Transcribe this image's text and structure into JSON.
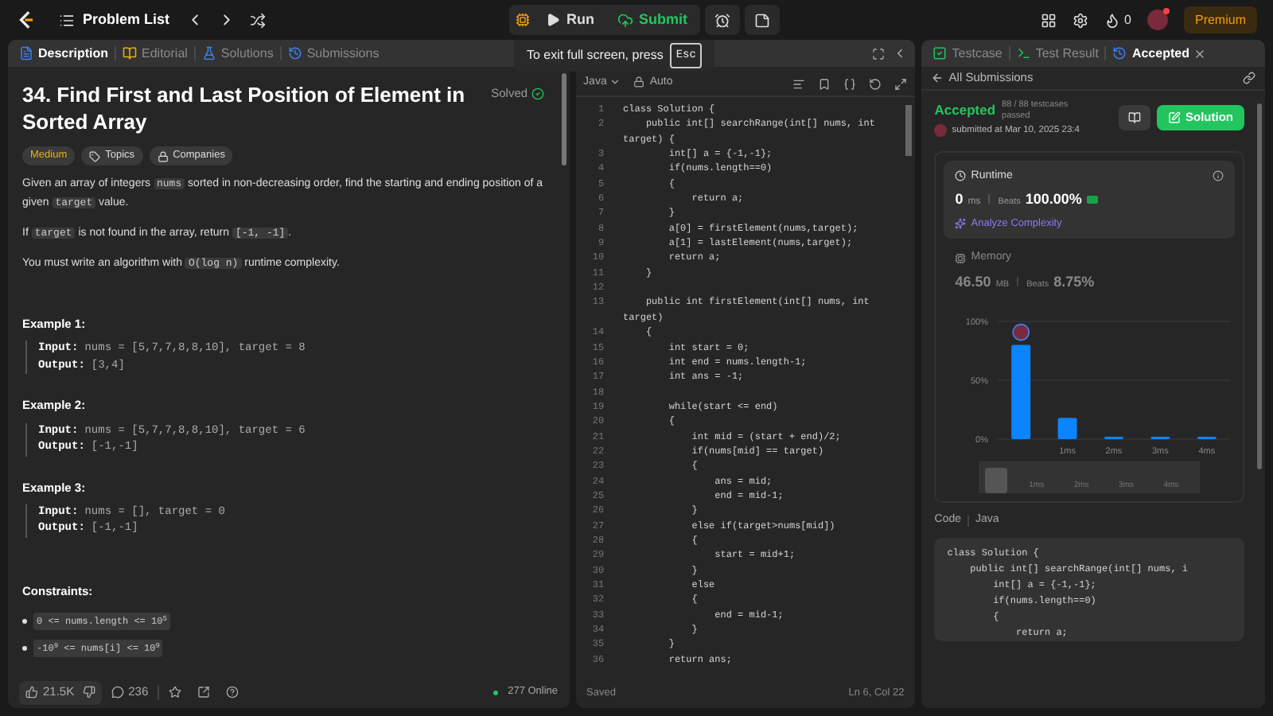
{
  "top_bar": {
    "title": "Problem List",
    "run": "Run",
    "submit": "Submit",
    "streak": "0",
    "premium": "Premium"
  },
  "fullscreen_tip": {
    "text": "To exit full screen, press",
    "key": "Esc"
  },
  "left_tabs": [
    {
      "label": "Description",
      "selected": true,
      "kind": "description"
    },
    {
      "label": "Editorial",
      "selected": false,
      "kind": "editorial"
    },
    {
      "label": "Solutions",
      "selected": false,
      "kind": "solutions"
    },
    {
      "label": "Submissions",
      "selected": false,
      "kind": "submissions"
    }
  ],
  "problem": {
    "title": "34. Find First and Last Position of Element in Sorted Array",
    "status": "Solved",
    "tags": [
      {
        "label": "Medium",
        "kind": "difficulty"
      },
      {
        "label": "Topics",
        "kind": "topics"
      },
      {
        "label": "Companies",
        "kind": "companies"
      }
    ],
    "paragraphs": [
      [
        {
          "kind": "text",
          "text": "Given an array of integers "
        },
        {
          "kind": "code",
          "text": "nums"
        },
        {
          "kind": "text",
          "text": " sorted in non-decreasing order, find the starting and ending position of a given "
        },
        {
          "kind": "code",
          "text": "target"
        },
        {
          "kind": "text",
          "text": " value."
        }
      ],
      [
        {
          "kind": "text",
          "text": "If "
        },
        {
          "kind": "code",
          "text": "target"
        },
        {
          "kind": "text",
          "text": " is not found in the array, return "
        },
        {
          "kind": "code",
          "text": "[-1, -1]"
        },
        {
          "kind": "text",
          "text": "."
        }
      ],
      [
        {
          "kind": "text",
          "text": "You must write an algorithm with "
        },
        {
          "kind": "code",
          "text": "O(log n)"
        },
        {
          "kind": "text",
          "text": " runtime complexity."
        }
      ]
    ],
    "examples": [
      {
        "title": "Example 1:",
        "input_label": "Input:",
        "input": "nums = [5,7,7,8,8,10], target = 8",
        "output_label": "Output:",
        "output": "[3,4]"
      },
      {
        "title": "Example 2:",
        "input_label": "Input:",
        "input": "nums = [5,7,7,8,8,10], target = 6",
        "output_label": "Output:",
        "output": "[-1,-1]"
      },
      {
        "title": "Example 3:",
        "input_label": "Input:",
        "input": "nums = [], target = 0",
        "output_label": "Output:",
        "output": "[-1,-1]"
      }
    ],
    "constraints_title": "Constraints:",
    "constraints": [
      "0 <= nums.length <= 10$^{5}$",
      "-10$^{9}$ <= nums[i] <= 10$^{9}$"
    ]
  },
  "footer": {
    "likes": "21.5K",
    "comments": "236",
    "online": "277 Online"
  },
  "editor": {
    "language": "Java",
    "mode": "Auto",
    "status": "Saved",
    "cursor": "Ln 6, Col 22",
    "lines": [
      {
        "number": "1",
        "text": "class Solution {"
      },
      {
        "number": "2",
        "text": "    public int[] searchRange(int[] nums, int"
      },
      {
        "text": "target) {"
      },
      {
        "number": "3",
        "text": "        int[] a = {-1,-1};"
      },
      {
        "number": "4",
        "text": "        if(nums.length==0)"
      },
      {
        "number": "5",
        "text": "        {"
      },
      {
        "number": "6",
        "text": "            return a;"
      },
      {
        "number": "7",
        "text": "        }"
      },
      {
        "number": "8",
        "text": "        a[0] = firstElement(nums,target);"
      },
      {
        "number": "9",
        "text": "        a[1] = lastElement(nums,target);"
      },
      {
        "number": "10",
        "text": "        return a;"
      },
      {
        "number": "11",
        "text": "    }"
      },
      {
        "number": "12"
      },
      {
        "number": "13",
        "text": "    public int firstElement(int[] nums, int"
      },
      {
        "text": "target)"
      },
      {
        "number": "14",
        "text": "    {"
      },
      {
        "number": "15",
        "text": "        int start = 0;"
      },
      {
        "number": "16",
        "text": "        int end = nums.length-1;"
      },
      {
        "number": "17",
        "text": "        int ans = -1;"
      },
      {
        "number": "18"
      },
      {
        "number": "19",
        "text": "        while(start <= end)"
      },
      {
        "number": "20",
        "text": "        {"
      },
      {
        "number": "21",
        "text": "            int mid = (start + end)/2;"
      },
      {
        "number": "22",
        "text": "            if(nums[mid] == target)"
      },
      {
        "number": "23",
        "text": "            {"
      },
      {
        "number": "24",
        "text": "                ans = mid;"
      },
      {
        "number": "25",
        "text": "                end = mid-1;"
      },
      {
        "number": "26",
        "text": "            }"
      },
      {
        "number": "27",
        "text": "            else if(target>nums[mid])"
      },
      {
        "number": "28",
        "text": "            {"
      },
      {
        "number": "29",
        "text": "                start = mid+1;"
      },
      {
        "number": "30",
        "text": "            }"
      },
      {
        "number": "31",
        "text": "            else"
      },
      {
        "number": "32",
        "text": "            {"
      },
      {
        "number": "33",
        "text": "                end = mid-1;"
      },
      {
        "number": "34",
        "text": "            }"
      },
      {
        "number": "35",
        "text": "        }"
      },
      {
        "number": "36",
        "text": "        return ans;"
      }
    ]
  },
  "right_tabs": [
    {
      "label": "Testcase",
      "selected": false,
      "kind": "testcase"
    },
    {
      "label": "Test Result",
      "selected": false,
      "kind": "result"
    },
    {
      "label": "Accepted",
      "selected": true,
      "kind": "accepted"
    }
  ],
  "submission": {
    "back": "All Submissions",
    "status": "Accepted",
    "testcases": "88 / 88 testcases passed",
    "submitted": "submitted at Mar 10, 2025 23:4",
    "solution": "Solution",
    "runtime": {
      "label": "Runtime",
      "value": "0",
      "unit": "ms",
      "beats_label": "Beats",
      "beats": "100.00%",
      "analyze": "Analyze Complexity"
    },
    "memory": {
      "label": "Memory",
      "value": "46.50",
      "unit": "MB",
      "beats_label": "Beats",
      "beats": "8.75%"
    },
    "chart_data": {
      "type": "bar",
      "x": [
        0,
        1,
        2,
        3,
        4
      ],
      "values": [
        80,
        18,
        2,
        2,
        2
      ],
      "xlim": [
        -0.5,
        4.5
      ],
      "ylim": [
        0,
        100
      ],
      "yticks": [
        {
          "value": 0,
          "label": "0%"
        },
        {
          "value": 50,
          "label": "50%"
        },
        {
          "value": 100,
          "label": "100%"
        }
      ],
      "xticks": [
        {
          "value": 1,
          "label": "1ms"
        },
        {
          "value": 2,
          "label": "2ms"
        },
        {
          "value": 3,
          "label": "3ms"
        },
        {
          "value": 4,
          "label": "4ms"
        }
      ]
    },
    "navigator_labels": [
      "1ms",
      "2ms",
      "3ms",
      "4ms"
    ],
    "code_label": "Code",
    "code_language": "Java",
    "code_preview": [
      "class Solution {",
      "    public int[] searchRange(int[] nums, i",
      "        int[] a = {-1,-1};",
      "        if(nums.length==0)",
      "        {",
      "            return a;"
    ]
  }
}
